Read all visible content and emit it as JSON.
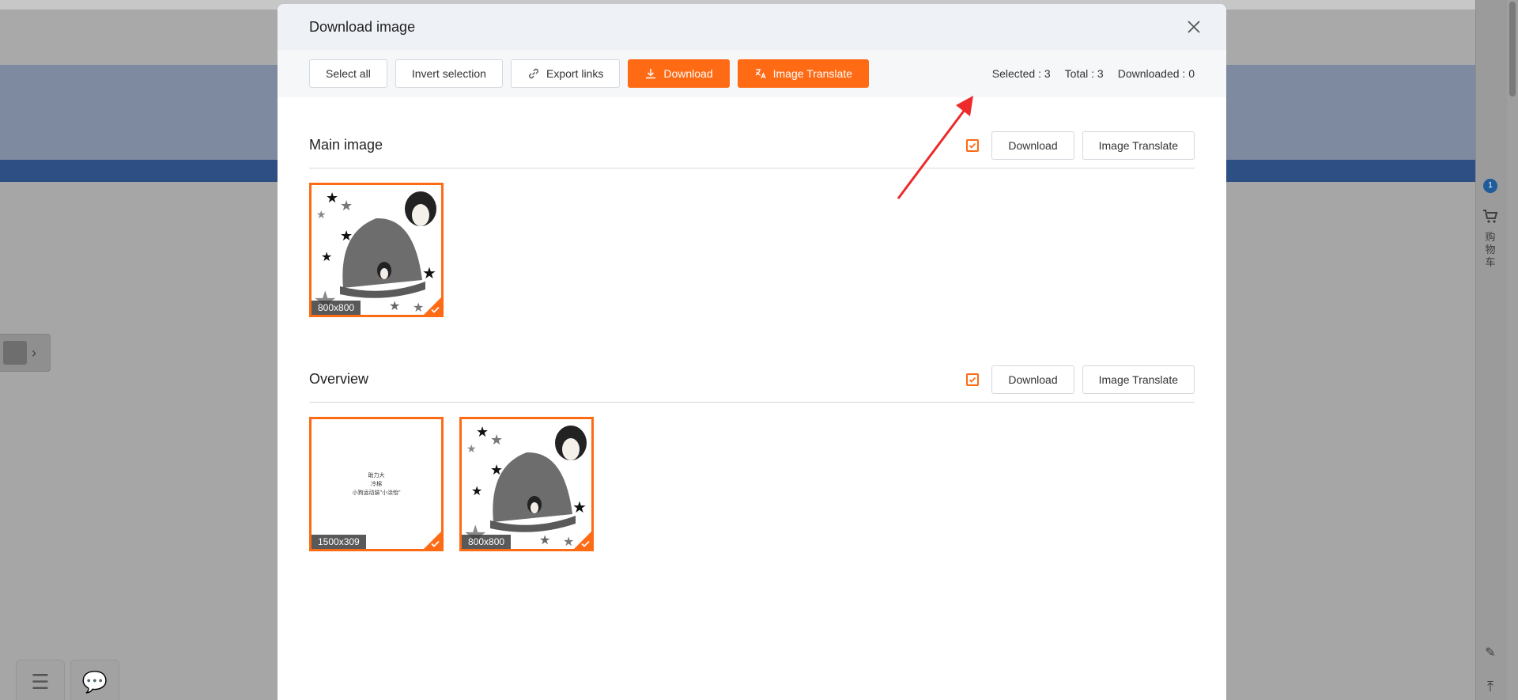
{
  "modal": {
    "title": "Download image"
  },
  "toolbar": {
    "select_all": "Select all",
    "invert_selection": "Invert selection",
    "export_links": "Export links",
    "download": "Download",
    "image_translate": "Image Translate"
  },
  "stats": {
    "selected": "Selected : 3",
    "total": "Total : 3",
    "downloaded": "Downloaded : 0"
  },
  "sections": [
    {
      "title": "Main image",
      "download": "Download",
      "image_translate": "Image Translate",
      "images": [
        {
          "dimensions": "800x800"
        }
      ]
    },
    {
      "title": "Overview",
      "download": "Download",
      "image_translate": "Image Translate",
      "images": [
        {
          "dimensions": "1500x309",
          "lines": [
            "助力大",
            "冷棉",
            "小狗运动装\"小涂怡\""
          ]
        },
        {
          "dimensions": "800x800"
        }
      ]
    }
  ],
  "sidebar": {
    "badge": "1",
    "cart_label": "购物车"
  },
  "colors": {
    "accent": "#ff6a14",
    "arrow": "#ee2a2a"
  }
}
